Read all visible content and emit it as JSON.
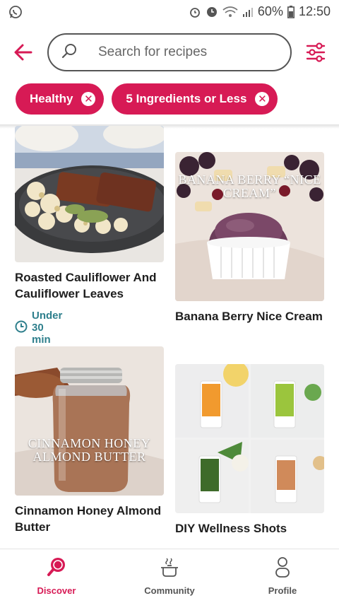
{
  "status_bar": {
    "battery": "60%",
    "time": "12:50",
    "left_icon": "whatsapp-icon"
  },
  "header": {
    "back_icon": "arrow-left-icon",
    "search_placeholder": "Search for recipes",
    "filter_icon": "sliders-icon"
  },
  "filters": [
    {
      "label": "Healthy"
    },
    {
      "label": "5 Ingredients or Less"
    }
  ],
  "recipes": [
    {
      "title": "Roasted Cauliflower And Cauliflower Leaves",
      "time": "Under 30 min"
    },
    {
      "title": "Banana Berry Nice Cream",
      "image_text": "BANANA BERRY “NICE CREAM”"
    },
    {
      "title": "Cinnamon Honey Almond Butter",
      "image_text": "CINNAMON HONEY ALMOND BUTTER"
    },
    {
      "title": "DIY Wellness Shots"
    }
  ],
  "nav": {
    "items": [
      {
        "label": "Discover",
        "icon": "magnifier-icon"
      },
      {
        "label": "Community",
        "icon": "pot-icon"
      },
      {
        "label": "Profile",
        "icon": "person-icon"
      }
    ],
    "active": "Discover"
  },
  "colors": {
    "accent": "#d71a55",
    "time_teal": "#2e7f8c"
  }
}
